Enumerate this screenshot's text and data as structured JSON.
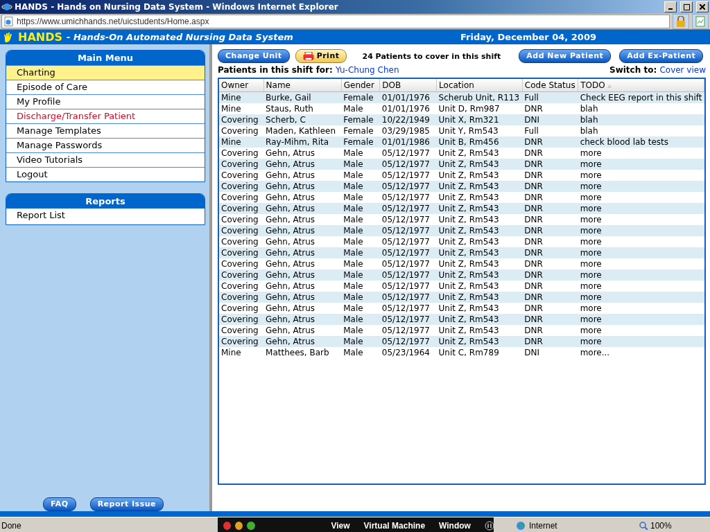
{
  "window": {
    "title": "HANDS - Hands on Nursing Data System - Windows Internet Explorer",
    "address": "https://www.umichhands.net/uicstudents/Home.aspx"
  },
  "header": {
    "logo": "HANDS",
    "subtitle": "- Hands-On Automated Nursing Data System",
    "date": "Friday, December 04, 2009"
  },
  "main_menu": {
    "title": "Main Menu",
    "items": [
      {
        "label": "Charting",
        "selected": true,
        "kind": "normal"
      },
      {
        "label": "Episode of Care",
        "selected": false,
        "kind": "normal"
      },
      {
        "label": "My Profile",
        "selected": false,
        "kind": "normal"
      },
      {
        "label": "Discharge/Transfer Patient",
        "selected": false,
        "kind": "alert"
      },
      {
        "label": "Manage Templates",
        "selected": false,
        "kind": "normal"
      },
      {
        "label": "Manage Passwords",
        "selected": false,
        "kind": "normal"
      },
      {
        "label": "Video Tutorials",
        "selected": false,
        "kind": "normal"
      },
      {
        "label": "Logout",
        "selected": false,
        "kind": "normal"
      }
    ]
  },
  "reports": {
    "title": "Reports",
    "items": [
      {
        "label": "Report List"
      }
    ]
  },
  "sidebar_buttons": [
    "FAQ",
    "Report Issue"
  ],
  "toolbar": {
    "change_unit": "Change Unit",
    "print": "Print",
    "count": "24 Patients to cover in this shift",
    "add_new": "Add New Patient",
    "add_ex": "Add Ex-Patient"
  },
  "shift": {
    "label": "Patients in this shift for:",
    "user": "Yu-Chung Chen",
    "switch_label": "Switch to:",
    "switch_link": "Cover view"
  },
  "table": {
    "columns": [
      "Owner",
      "Name",
      "Gender",
      "DOB",
      "Location",
      "Code Status",
      "TODO"
    ],
    "rows": [
      [
        "Mine",
        "Burke, Gail",
        "Female",
        "01/01/1976",
        "Scherub Unit, R113",
        "Full",
        "Check EEG report in this shift"
      ],
      [
        "Mine",
        "Staus, Ruth",
        "Male",
        "01/01/1976",
        "Unit D, Rm987",
        "DNR",
        "blah"
      ],
      [
        "Covering",
        "Scherb, C",
        "Female",
        "10/22/1949",
        "Unit X, Rm321",
        "DNI",
        "blah"
      ],
      [
        "Covering",
        "Maden, Kathleen",
        "Female",
        "03/29/1985",
        "Unit Y, Rm543",
        "Full",
        "blah"
      ],
      [
        "Mine",
        "Ray-Mihm, Rita",
        "Female",
        "01/01/1986",
        "Unit B, Rm456",
        "DNR",
        "check blood lab tests"
      ],
      [
        "Covering",
        "Gehn, Atrus",
        "Male",
        "05/12/1977",
        "Unit Z, Rm543",
        "DNR",
        "more"
      ],
      [
        "Covering",
        "Gehn, Atrus",
        "Male",
        "05/12/1977",
        "Unit Z, Rm543",
        "DNR",
        "more"
      ],
      [
        "Covering",
        "Gehn, Atrus",
        "Male",
        "05/12/1977",
        "Unit Z, Rm543",
        "DNR",
        "more"
      ],
      [
        "Covering",
        "Gehn, Atrus",
        "Male",
        "05/12/1977",
        "Unit Z, Rm543",
        "DNR",
        "more"
      ],
      [
        "Covering",
        "Gehn, Atrus",
        "Male",
        "05/12/1977",
        "Unit Z, Rm543",
        "DNR",
        "more"
      ],
      [
        "Covering",
        "Gehn, Atrus",
        "Male",
        "05/12/1977",
        "Unit Z, Rm543",
        "DNR",
        "more"
      ],
      [
        "Covering",
        "Gehn, Atrus",
        "Male",
        "05/12/1977",
        "Unit Z, Rm543",
        "DNR",
        "more"
      ],
      [
        "Covering",
        "Gehn, Atrus",
        "Male",
        "05/12/1977",
        "Unit Z, Rm543",
        "DNR",
        "more"
      ],
      [
        "Covering",
        "Gehn, Atrus",
        "Male",
        "05/12/1977",
        "Unit Z, Rm543",
        "DNR",
        "more"
      ],
      [
        "Covering",
        "Gehn, Atrus",
        "Male",
        "05/12/1977",
        "Unit Z, Rm543",
        "DNR",
        "more"
      ],
      [
        "Covering",
        "Gehn, Atrus",
        "Male",
        "05/12/1977",
        "Unit Z, Rm543",
        "DNR",
        "more"
      ],
      [
        "Covering",
        "Gehn, Atrus",
        "Male",
        "05/12/1977",
        "Unit Z, Rm543",
        "DNR",
        "more"
      ],
      [
        "Covering",
        "Gehn, Atrus",
        "Male",
        "05/12/1977",
        "Unit Z, Rm543",
        "DNR",
        "more"
      ],
      [
        "Covering",
        "Gehn, Atrus",
        "Male",
        "05/12/1977",
        "Unit Z, Rm543",
        "DNR",
        "more"
      ],
      [
        "Covering",
        "Gehn, Atrus",
        "Male",
        "05/12/1977",
        "Unit Z, Rm543",
        "DNR",
        "more"
      ],
      [
        "Covering",
        "Gehn, Atrus",
        "Male",
        "05/12/1977",
        "Unit Z, Rm543",
        "DNR",
        "more"
      ],
      [
        "Covering",
        "Gehn, Atrus",
        "Male",
        "05/12/1977",
        "Unit Z, Rm543",
        "DNR",
        "more"
      ],
      [
        "Covering",
        "Gehn, Atrus",
        "Male",
        "05/12/1977",
        "Unit Z, Rm543",
        "DNR",
        "more"
      ],
      [
        "Mine",
        "Matthees, Barb",
        "Male",
        "05/23/1964",
        "Unit C, Rm789",
        "DNI",
        "more..."
      ]
    ]
  },
  "status_bar": {
    "text": "Done",
    "vm_menu": [
      "View",
      "Virtual Machine",
      "Window"
    ],
    "zone": "Internet",
    "zoom": "100%"
  }
}
